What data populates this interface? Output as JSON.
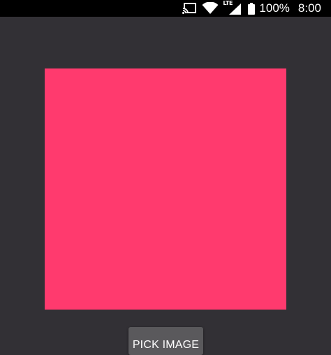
{
  "status_bar": {
    "network_label": "LTE",
    "battery": "100%",
    "time": "8:00",
    "icons": [
      "cast-icon",
      "wifi-icon",
      "cell-signal-icon",
      "battery-icon"
    ]
  },
  "preview": {
    "color": "#ff3a6e"
  },
  "actions": {
    "pick_label": "PICK IMAGE"
  },
  "colors": {
    "background": "#323035",
    "status_bar": "#000000",
    "button": "#5a595c"
  }
}
